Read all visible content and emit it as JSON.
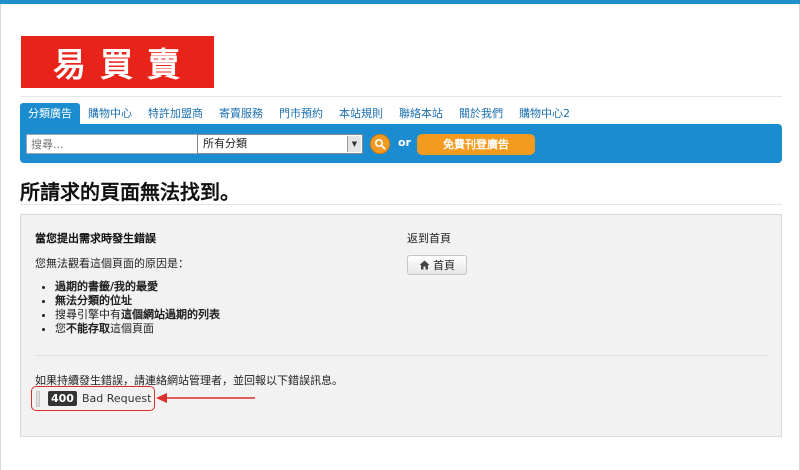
{
  "logo": {
    "text": "易買賣"
  },
  "nav": {
    "items": [
      {
        "label": "分類廣告",
        "active": true
      },
      {
        "label": "購物中心",
        "active": false
      },
      {
        "label": "特許加盟商",
        "active": false
      },
      {
        "label": "寄賣服務",
        "active": false
      },
      {
        "label": "門市預約",
        "active": false
      },
      {
        "label": "本站規則",
        "active": false
      },
      {
        "label": "聯絡本站",
        "active": false
      },
      {
        "label": "關於我們",
        "active": false
      },
      {
        "label": "購物中心2",
        "active": false
      }
    ]
  },
  "search": {
    "placeholder": "搜尋...",
    "category_selected": "所有分類",
    "or_text": "or",
    "post_button": "免費刊登廣告"
  },
  "page": {
    "title": "所請求的頁面無法找到。"
  },
  "error": {
    "heading": "當您提出需求時發生錯誤",
    "reason_intro": "您無法觀看這個頁面的原因是：",
    "reasons": [
      {
        "prefix": "",
        "bold": "過期的書籤/我的最愛",
        "suffix": ""
      },
      {
        "prefix": "",
        "bold": "無法分類的位址",
        "suffix": ""
      },
      {
        "prefix": "搜尋引擎中有",
        "bold": "這個網站過期的列表",
        "suffix": ""
      },
      {
        "prefix": "您",
        "bold": "不能存取",
        "suffix": "這個頁面"
      }
    ],
    "home_label": "返到首頁",
    "home_button": "首頁",
    "persist_message": "如果持續發生錯誤，請連絡網站管理者，並回報以下錯誤訊息。",
    "code": "400",
    "code_text": "Bad Request"
  },
  "colors": {
    "brand_blue": "#1b8ccf",
    "logo_red": "#e8231a",
    "accent_orange": "#f39a1f",
    "highlight_red": "#d9302c"
  },
  "icons": {
    "search": "magnifier-icon",
    "home": "home-icon",
    "dropdown": "chevron-down-icon",
    "annotation": "red-arrow-icon"
  }
}
